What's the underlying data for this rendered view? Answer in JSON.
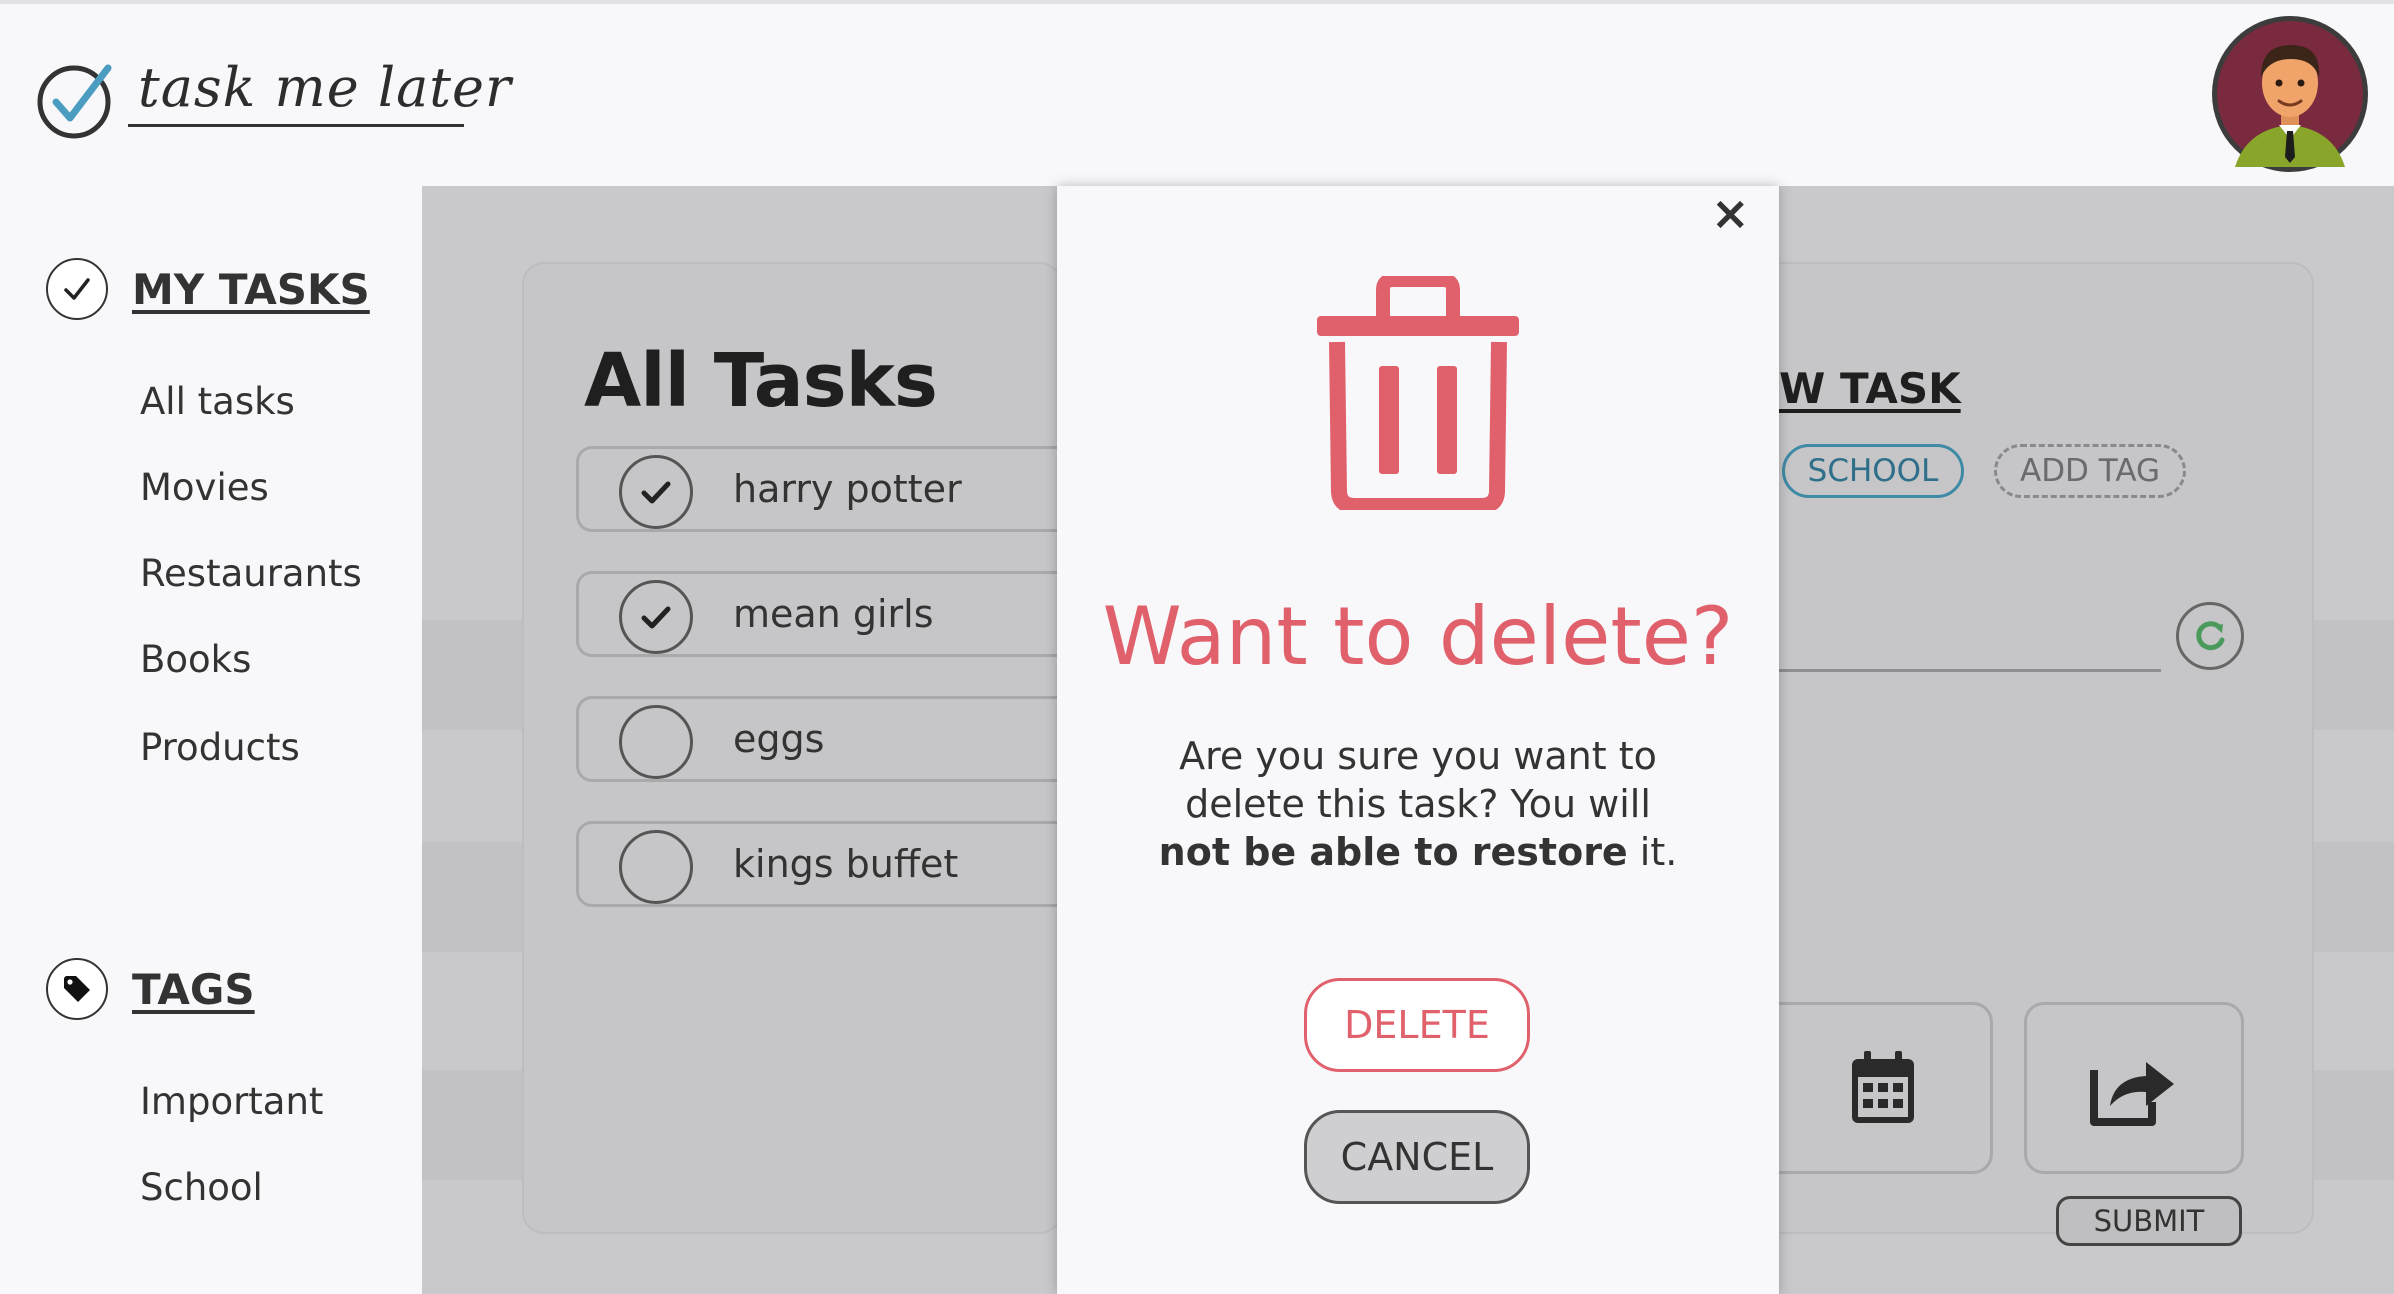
{
  "app": {
    "logo_text": "task me later"
  },
  "sidebar": {
    "my_tasks_title": "MY TASKS",
    "task_lists": [
      "All tasks",
      "Movies",
      "Restaurants",
      "Books",
      "Products"
    ],
    "tags_title": "TAGS",
    "tags": [
      "Important",
      "School"
    ]
  },
  "main": {
    "title": "All Tasks",
    "tasks": [
      {
        "label": "harry potter",
        "done": true
      },
      {
        "label": "mean girls",
        "done": true
      },
      {
        "label": "eggs",
        "done": false
      },
      {
        "label": "kings buffet",
        "done": false
      }
    ]
  },
  "new_task": {
    "title_partial": "W TASK",
    "tag_chip": "SCHOOL",
    "add_tag": "ADD TAG",
    "submit_label": "SUBMIT"
  },
  "modal": {
    "close_glyph": "×",
    "title": "Want to delete?",
    "body_part1": "Are you sure you want to delete this task? You will ",
    "body_bold": "not be able to restore",
    "body_part2": " it.",
    "delete_label": "DELETE",
    "cancel_label": "CANCEL"
  },
  "colors": {
    "accent_red": "#e0616b",
    "chip_blue": "#3f8aa5",
    "check_blue": "#4a9cc0",
    "refresh_green": "#4a9a5c"
  }
}
